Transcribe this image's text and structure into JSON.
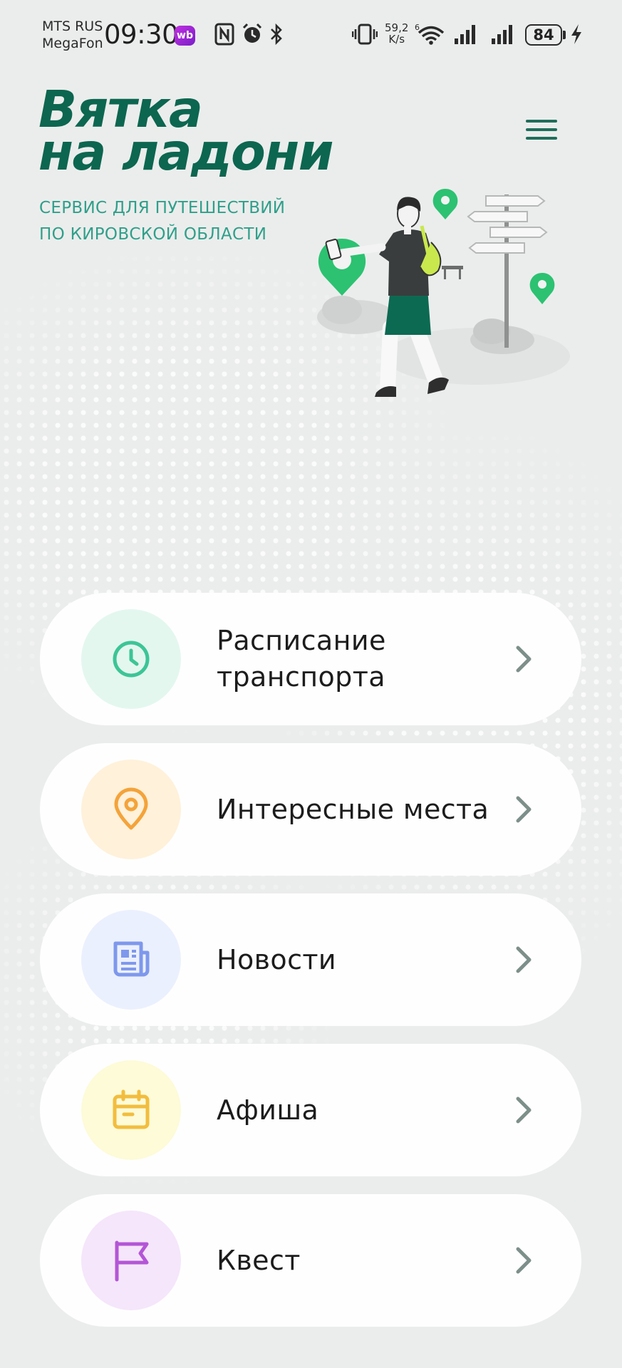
{
  "status": {
    "carrier_line1": "MTS RUS",
    "carrier_line2": "MegaFon",
    "time": "09:30",
    "wb_badge": "wb",
    "speed_value": "59,2",
    "speed_unit": "K/s",
    "battery": "84"
  },
  "header": {
    "logo_line1": "Вятка",
    "logo_line2": "на ладони",
    "tagline_line1": "СЕРВИС ДЛЯ ПУТЕШЕСТВИЙ",
    "tagline_line2": "ПО КИРОВСКОЙ ОБЛАСТИ",
    "menu_icon": "hamburger-icon"
  },
  "menu": {
    "items": [
      {
        "line1": "Расписание",
        "line2": "транспорта",
        "icon": "clock-icon",
        "bg": "#e3f7ef",
        "color": "#3cc596"
      },
      {
        "line1": "Интересные места",
        "line2": "",
        "icon": "location-pin-icon",
        "bg": "#fff1da",
        "color": "#f4a33a"
      },
      {
        "line1": "Новости",
        "line2": "",
        "icon": "newspaper-icon",
        "bg": "#ebf0fe",
        "color": "#7e98ec"
      },
      {
        "line1": "Афиша",
        "line2": "",
        "icon": "calendar-icon",
        "bg": "#fdfbd8",
        "color": "#f2bd3e"
      },
      {
        "line1": "Квест",
        "line2": "",
        "icon": "flag-icon",
        "bg": "#f5e6fb",
        "color": "#b456d6"
      }
    ]
  },
  "colors": {
    "brand": "#0c6650",
    "accent": "#2fbf73",
    "chevron": "#7d8f8a",
    "background": "#ebedec"
  }
}
